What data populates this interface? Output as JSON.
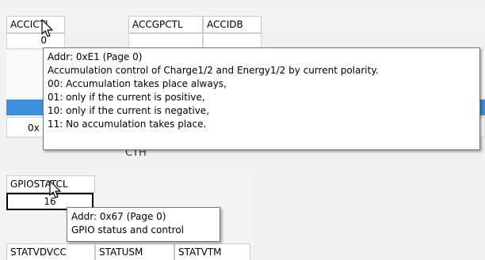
{
  "registers_top": {
    "headers": [
      "ACCICTL",
      "ACCGPCTL",
      "ACCIDB"
    ],
    "value_first_partial": "0",
    "value_row3_partial": "0x",
    "value_row3_right_partial": "CTH"
  },
  "tooltip_top": {
    "lines": [
      "Addr: 0xE1 (Page 0)",
      "Accumulation control of Charge1/2 and Energy1/2 by current polarity.",
      "00: Accumulation takes place always,",
      "01: only if the current is positive,",
      "10: only if the current is negative,",
      "11: No accumulation takes place."
    ]
  },
  "registers_bottom": {
    "header": "GPIOSTATCL",
    "value": "16",
    "footer_headers": [
      "STATVDVCC",
      "STATUSM",
      "STATVTM"
    ]
  },
  "tooltip_bottom": {
    "lines": [
      "Addr: 0x67 (Page 0)",
      "GPIO status and control"
    ]
  },
  "colors": {
    "selection_band": "#3d8fd9",
    "background": "#f0f0f0"
  }
}
